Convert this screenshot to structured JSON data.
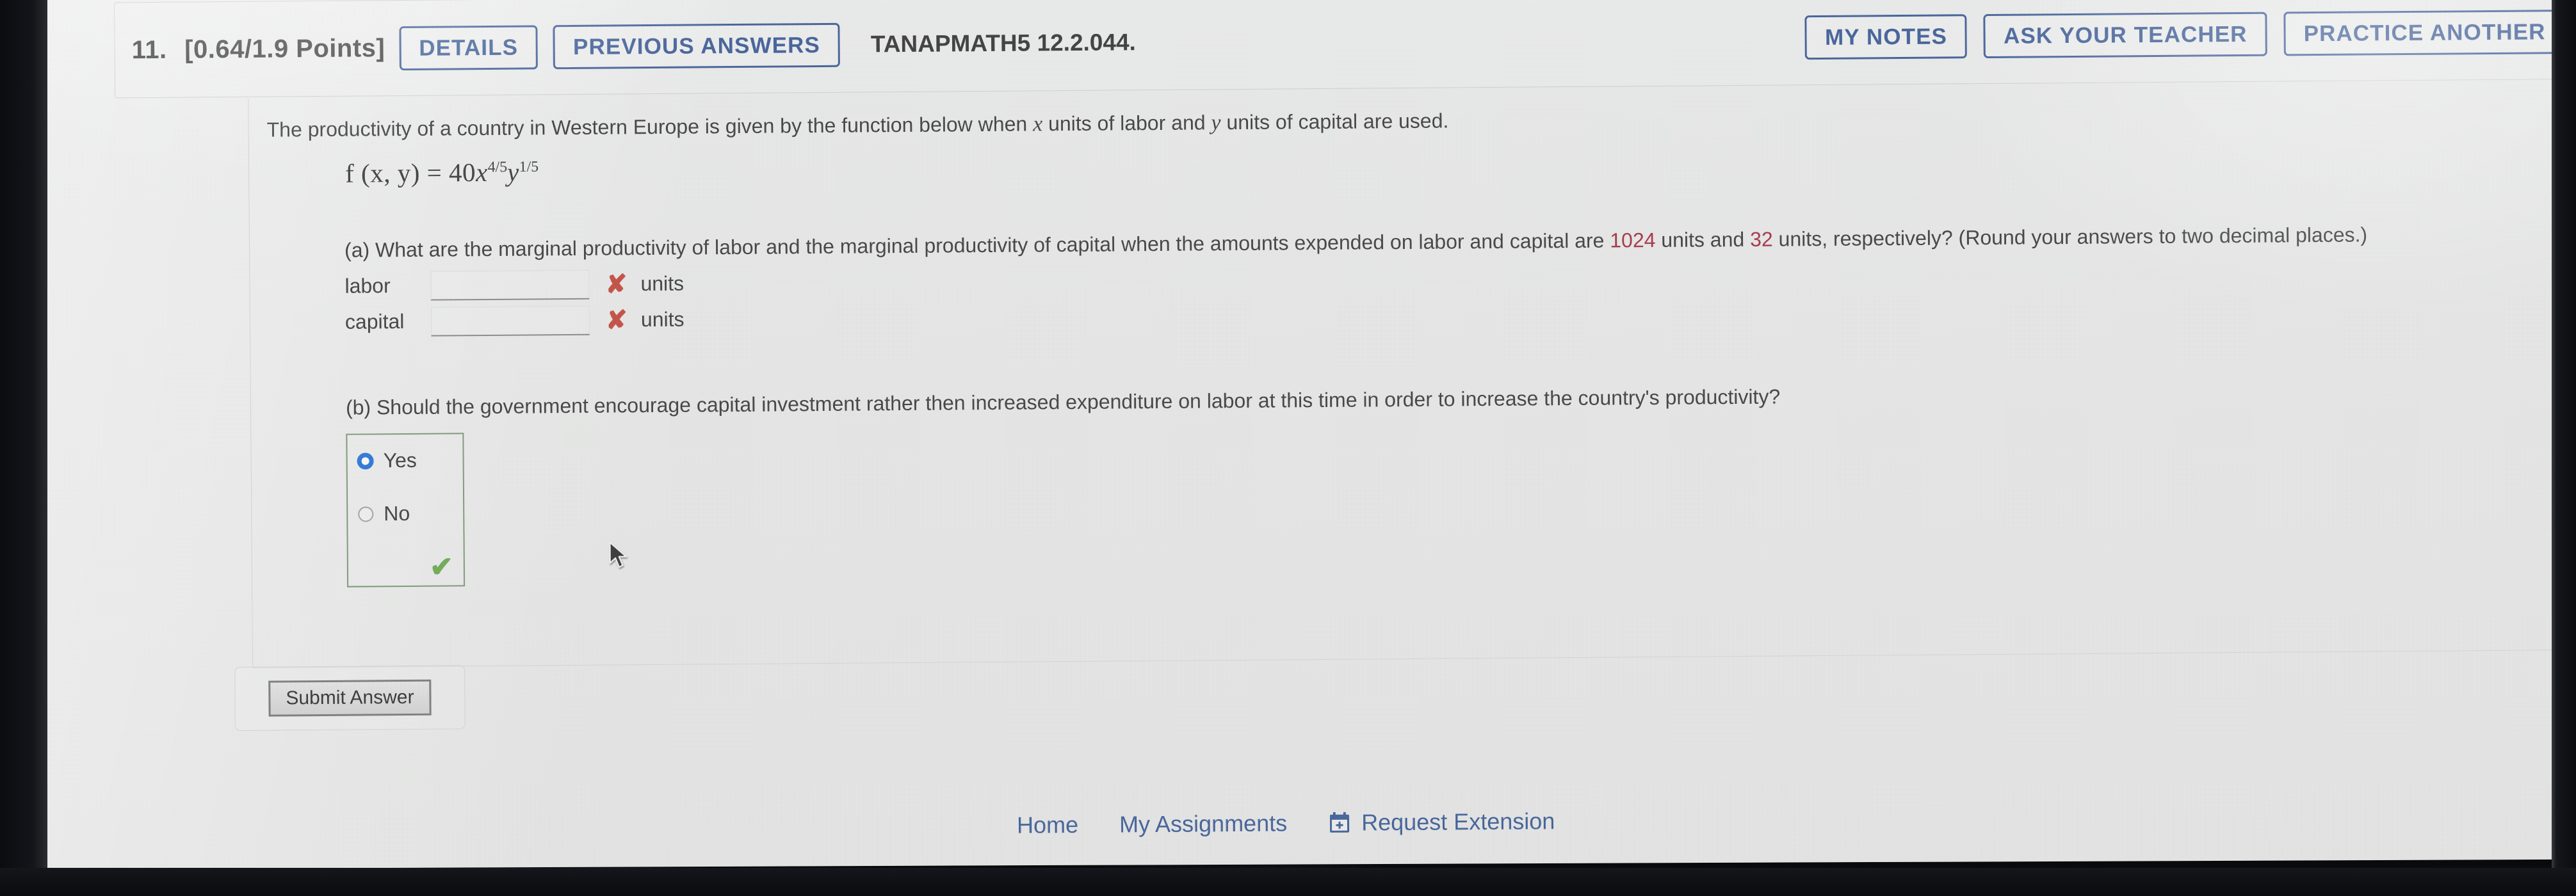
{
  "header": {
    "question_number": "11.",
    "points": "[0.64/1.9 Points]",
    "details_label": "DETAILS",
    "previous_answers_label": "PREVIOUS ANSWERS",
    "question_code": "TANAPMATH5 12.2.044.",
    "my_notes_label": "MY NOTES",
    "ask_teacher_label": "ASK YOUR TEACHER",
    "practice_another_label": "PRACTICE ANOTHER",
    "button_color": "#2c4f8f"
  },
  "body": {
    "prompt_before_x": "The productivity of a country in Western Europe is given by the function below when ",
    "prompt_var_x": "x",
    "prompt_middle": " units of labor and ",
    "prompt_var_y": "y",
    "prompt_after_y": " units of capital are used.",
    "formula": {
      "lhs": "f (x, y) =",
      "coefficient": "40",
      "base_x": "x",
      "exp_x": "4/5",
      "base_y": "y",
      "exp_y": "1/5",
      "plain": "f(x, y) = 40x^(4/5)y^(1/5)"
    },
    "part_a": {
      "text_1": "(a) What are the marginal productivity of labor and the marginal productivity of capital when the amounts expended on labor and capital are ",
      "value_labor": "1024",
      "text_2": " units and ",
      "value_capital": "32",
      "text_3": " units, respectively? (Round your answers to two decimal places.)",
      "highlight_color": "#9d1b30",
      "rows": [
        {
          "label": "labor",
          "value": "",
          "mark": "✘",
          "unit": "units"
        },
        {
          "label": "capital",
          "value": "",
          "mark": "✘",
          "unit": "units"
        }
      ],
      "mark_color": "#c0392b"
    },
    "part_b": {
      "text": "(b) Should the government encourage capital investment rather then increased expenditure on labor at this time in order to increase the country's productivity?",
      "options": [
        {
          "label": "Yes",
          "selected": true
        },
        {
          "label": "No",
          "selected": false
        }
      ],
      "correct_mark": "✔",
      "correct_color": "#5fa343",
      "box_border_color": "#6f8f6a"
    }
  },
  "submit": {
    "label": "Submit Answer"
  },
  "bottom_nav": {
    "home": "Home",
    "my_assignments": "My Assignments",
    "calendar_icon": "calendar-plus-icon",
    "request_extension": "Request Extension",
    "link_color": "#2c4f8f"
  }
}
